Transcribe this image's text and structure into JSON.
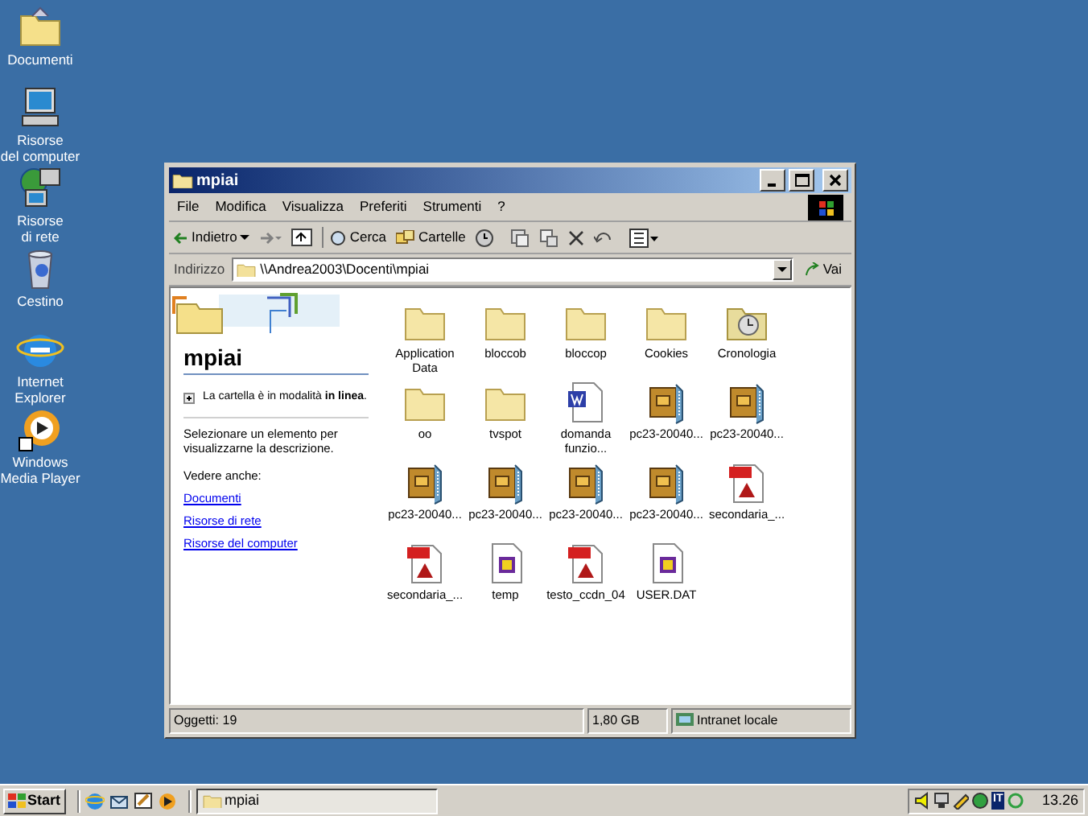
{
  "desktop_icons": [
    {
      "label": "Documenti",
      "kind": "documents"
    },
    {
      "label": "Risorse del computer",
      "kind": "computer"
    },
    {
      "label": "Risorse di rete",
      "kind": "network"
    },
    {
      "label": "Cestino",
      "kind": "bin"
    },
    {
      "label": "Internet Explorer",
      "kind": "ie"
    },
    {
      "label": "Windows Media Player",
      "kind": "media"
    }
  ],
  "window": {
    "title": "mpiai",
    "menu": [
      "File",
      "Modifica",
      "Visualizza",
      "Preferiti",
      "Strumenti",
      "?"
    ],
    "toolbar": {
      "back": "Indietro",
      "search": "Cerca",
      "folders": "Cartelle"
    },
    "address": {
      "label": "Indirizzo",
      "value": "\\\\Andrea2003\\Docenti\\mpiai",
      "go": "Vai"
    },
    "side_panel": {
      "heading": "mpiai",
      "status": "La cartella è in modalità **in linea**.",
      "hint": "Selezionare un elemento per visualizzarne la descrizione.",
      "see_also": "Vedere anche:",
      "links": [
        "Documenti",
        "Risorse di rete",
        "Risorse del computer"
      ]
    },
    "files": [
      {
        "name": "Application Data",
        "kind": "folder"
      },
      {
        "name": "bloccob",
        "kind": "folder"
      },
      {
        "name": "bloccop",
        "kind": "folder"
      },
      {
        "name": "Cookies",
        "kind": "folder"
      },
      {
        "name": "Cronologia",
        "kind": "history"
      },
      {
        "name": "oo",
        "kind": "folder"
      },
      {
        "name": "tvspot",
        "kind": "folder"
      },
      {
        "name": "domanda funzio...",
        "kind": "word"
      },
      {
        "name": "pc23-20040...",
        "kind": "zip"
      },
      {
        "name": "pc23-20040...",
        "kind": "zip"
      },
      {
        "name": "pc23-20040...",
        "kind": "zip"
      },
      {
        "name": "pc23-20040...",
        "kind": "zip"
      },
      {
        "name": "pc23-20040...",
        "kind": "zip"
      },
      {
        "name": "pc23-20040...",
        "kind": "zip"
      },
      {
        "name": "secondaria_...",
        "kind": "pdf"
      },
      {
        "name": "secondaria_...",
        "kind": "pdf"
      },
      {
        "name": "temp",
        "kind": "dat"
      },
      {
        "name": "testo_ccdn_04",
        "kind": "pdf"
      },
      {
        "name": "USER.DAT",
        "kind": "dat"
      }
    ],
    "status_bar": {
      "objects": "Oggetti: 19",
      "size": "1,80 GB",
      "zone": "Intranet locale"
    }
  },
  "taskbar": {
    "start": "Start",
    "tasks": [
      {
        "label": "mpiai",
        "selected": true
      }
    ],
    "language": "IT",
    "clock": "13.26"
  }
}
